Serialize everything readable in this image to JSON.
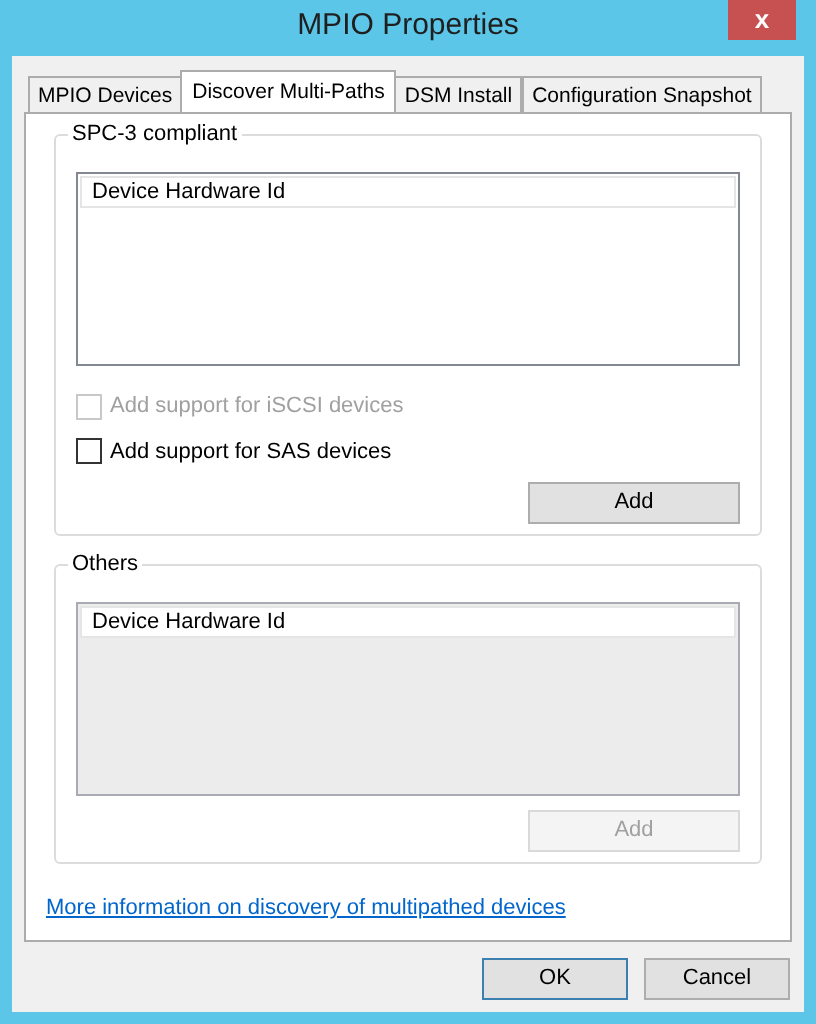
{
  "window": {
    "title": "MPIO Properties",
    "close": "x"
  },
  "tabs": [
    {
      "label": "MPIO Devices",
      "selected": false
    },
    {
      "label": "Discover Multi-Paths",
      "selected": true
    },
    {
      "label": "DSM Install",
      "selected": false
    },
    {
      "label": "Configuration Snapshot",
      "selected": false
    }
  ],
  "groups": [
    {
      "legend": "SPC-3 compliant",
      "list": {
        "header": "Device Hardware Id",
        "disabled": false
      },
      "checkboxes": [
        {
          "label": "Add support for iSCSI devices",
          "checked": false,
          "disabled": true
        },
        {
          "label": "Add support for SAS devices",
          "checked": false,
          "disabled": false
        }
      ],
      "add_button": {
        "label": "Add",
        "disabled": false
      }
    },
    {
      "legend": "Others",
      "list": {
        "header": "Device Hardware Id",
        "disabled": true
      },
      "add_button": {
        "label": "Add",
        "disabled": true
      }
    }
  ],
  "link": "More information on discovery of multipathed devices",
  "buttons": [
    {
      "label": "OK",
      "default": true
    },
    {
      "label": "Cancel",
      "default": false
    }
  ]
}
